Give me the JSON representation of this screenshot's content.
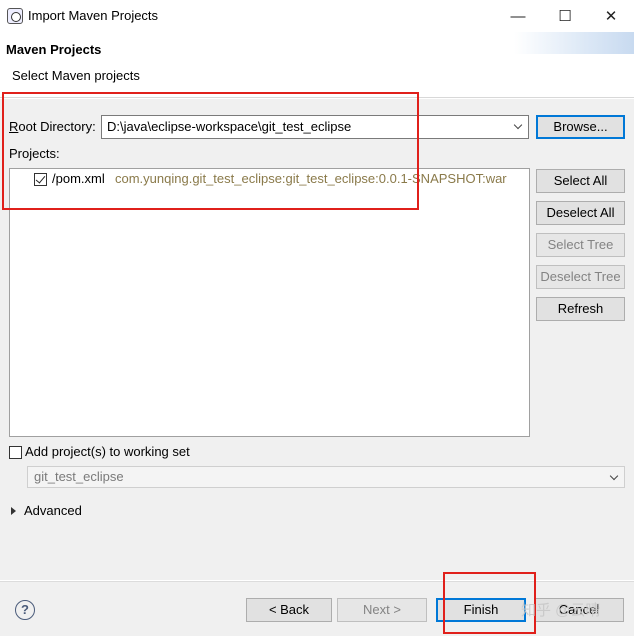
{
  "window": {
    "title": "Import Maven Projects",
    "minimize_glyph": "—",
    "maximize_glyph": "☐",
    "close_glyph": "✕"
  },
  "header": {
    "title": "Maven Projects",
    "message": "Select Maven projects"
  },
  "root_directory": {
    "label_prefix": "",
    "label_mnemonic": "R",
    "label_rest": "oot Directory:",
    "value": "D:\\java\\eclipse-workspace\\git_test_eclipse",
    "browse_label": "Browse..."
  },
  "projects": {
    "label": "Projects:",
    "items": [
      {
        "checked": true,
        "path": "/pom.xml",
        "artifact": "com.yunqing.git_test_eclipse:git_test_eclipse:0.0.1-SNAPSHOT:war"
      }
    ]
  },
  "side_buttons": {
    "select_all": "Select All",
    "deselect_all": "Deselect All",
    "select_tree": "Select Tree",
    "deselect_tree": "Deselect Tree",
    "refresh": "Refresh"
  },
  "working_set": {
    "checkbox_label": "Add project(s) to working set",
    "checked": false,
    "combo_value": "git_test_eclipse"
  },
  "advanced": {
    "label": "Advanced"
  },
  "footer": {
    "help_glyph": "?",
    "back": "< Back",
    "next": "Next >",
    "finish": "Finish",
    "cancel": "Cancel"
  },
  "watermark": "知乎 @云晴",
  "colors": {
    "annotation_red": "#e0201b",
    "artifact_text": "#8a7a4a",
    "focus_blue": "#0078d7"
  }
}
